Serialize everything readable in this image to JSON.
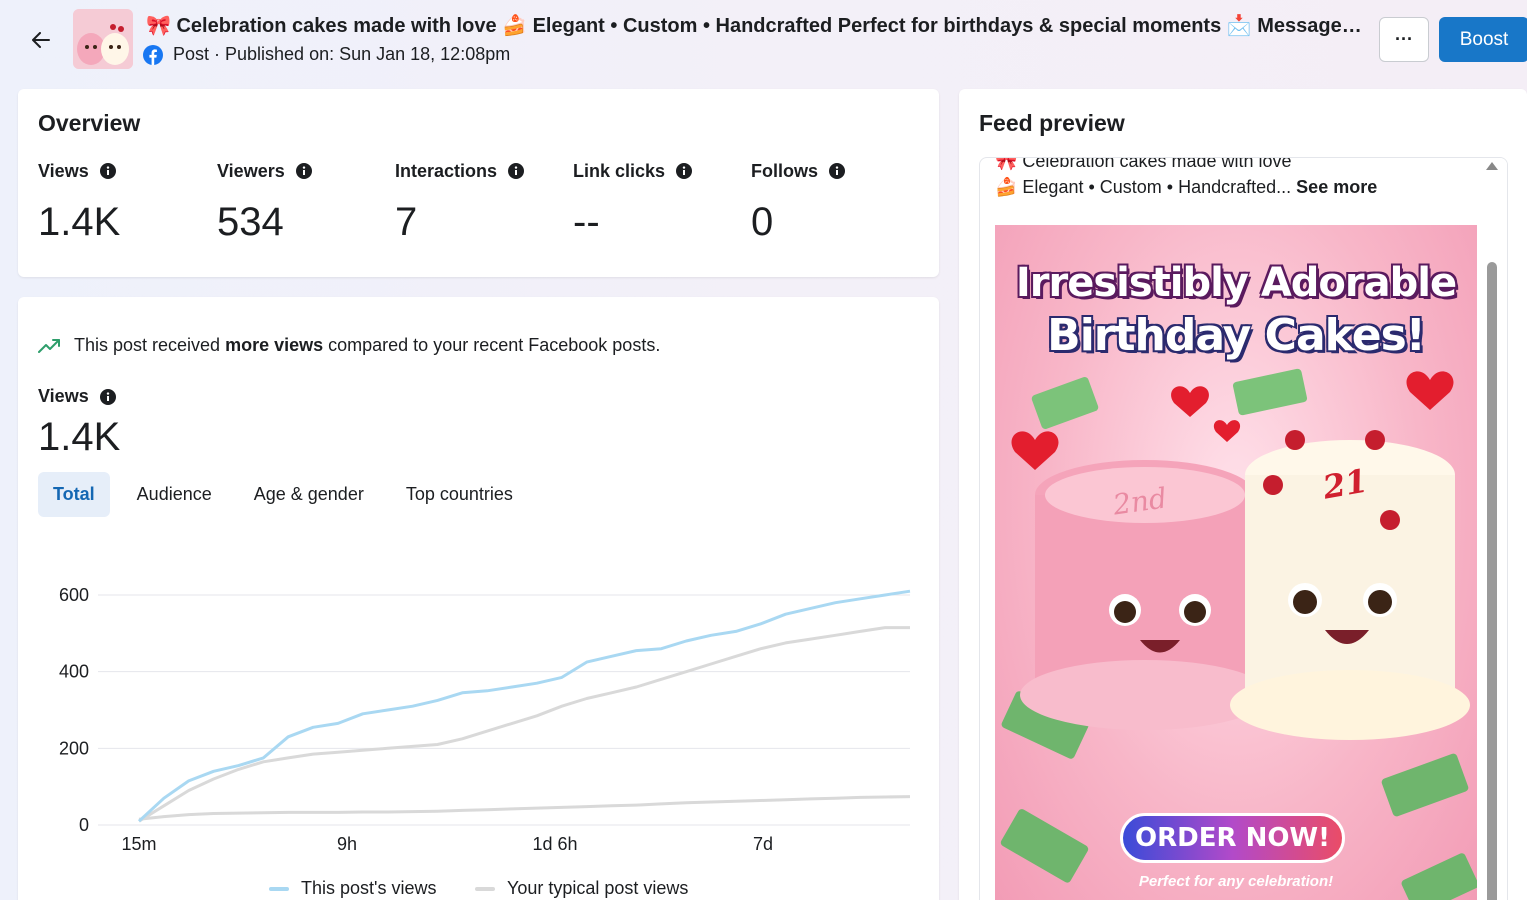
{
  "header": {
    "back_label": "Back",
    "title": "🎀 Celebration cakes made with love 🍰 Elegant • Custom • Handcrafted Perfect for birthdays & special moments 📩 Message us to order",
    "subtitle": "Post · Published on: Sun Jan 18, 12:08pm",
    "more_label": "···",
    "boost_label": "Boost"
  },
  "overview": {
    "title": "Overview",
    "metrics": [
      {
        "label": "Views",
        "value": "1.4K"
      },
      {
        "label": "Viewers",
        "value": "534"
      },
      {
        "label": "Interactions",
        "value": "7"
      },
      {
        "label": "Link clicks",
        "value": "--"
      },
      {
        "label": "Follows",
        "value": "0"
      }
    ]
  },
  "views_panel": {
    "notice_prefix": "This post received ",
    "notice_bold": "more views",
    "notice_suffix": " compared to your recent Facebook posts.",
    "label": "Views",
    "value": "1.4K",
    "tabs": [
      "Total",
      "Audience",
      "Age & gender",
      "Top countries"
    ],
    "active_tab": "Total"
  },
  "chart_data": {
    "type": "line",
    "title": "",
    "xlabel": "",
    "ylabel": "",
    "x_tick_labels": [
      "15m",
      "9h",
      "1d 6h",
      "7d"
    ],
    "ylim": [
      0,
      600
    ],
    "y_ticks": [
      0,
      200,
      400,
      600
    ],
    "grid": true,
    "legend_position": "bottom",
    "colors": {
      "this_post": "#a9d8f2",
      "typical": "#d9d9d9",
      "band_low": "#d9d9d9"
    },
    "series": [
      {
        "name": "This post's views",
        "values": [
          10,
          70,
          115,
          140,
          155,
          175,
          230,
          255,
          265,
          290,
          300,
          310,
          325,
          345,
          350,
          360,
          370,
          385,
          425,
          440,
          455,
          460,
          480,
          495,
          505,
          525,
          550,
          565,
          580,
          590,
          600,
          610
        ]
      },
      {
        "name": "Your typical post views",
        "values": [
          10,
          50,
          90,
          120,
          145,
          165,
          175,
          185,
          190,
          195,
          200,
          205,
          210,
          225,
          245,
          265,
          285,
          310,
          330,
          345,
          360,
          380,
          400,
          420,
          440,
          460,
          475,
          485,
          495,
          505,
          515,
          515
        ]
      },
      {
        "values": [
          15,
          22,
          27,
          30,
          31,
          32,
          33,
          33,
          33,
          34,
          34,
          35,
          36,
          38,
          40,
          42,
          44,
          46,
          48,
          50,
          52,
          55,
          58,
          60,
          62,
          64,
          66,
          68,
          70,
          72,
          73,
          74
        ]
      }
    ]
  },
  "feed_preview": {
    "title": "Feed preview",
    "line1": "🎀 Celebration cakes made with love",
    "line2": "🍰 Elegant • Custom • Handcrafted...",
    "see_more": "See more",
    "ad_headline_1": "Irresistibly Adorable",
    "ad_headline_2": "Birthday Cakes!",
    "ad_cake_left": "2nd",
    "ad_cake_right": "21",
    "ad_button": "ORDER NOW!",
    "ad_tagline": "Perfect for any celebration!"
  },
  "icons": {
    "back": "arrow-left-icon",
    "facebook": "facebook-icon",
    "info": "info-icon",
    "trend": "trending-up-icon"
  }
}
